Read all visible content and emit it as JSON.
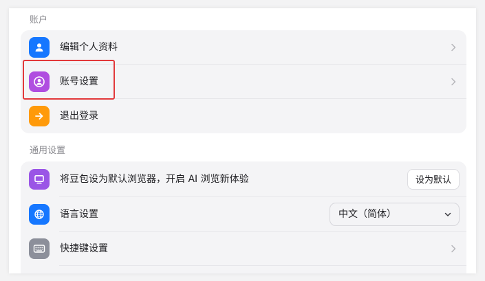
{
  "sections": {
    "account_title": "账户",
    "general_title": "通用设置"
  },
  "account": {
    "items": [
      {
        "label": "编辑个人资料",
        "icon": "person-icon",
        "icon_color": "#1677ff"
      },
      {
        "label": "账号设置",
        "icon": "account-circle-icon",
        "icon_color": "#b04ee0"
      },
      {
        "label": "退出登录",
        "icon": "arrow-right-icon",
        "icon_color": "#ff9a0a"
      }
    ]
  },
  "general": {
    "default_browser": {
      "label": "将豆包设为默认浏览器，开启 AI 浏览新体验",
      "button": "设为默认",
      "icon": "monitor-icon",
      "icon_color": "#9a55e6"
    },
    "language": {
      "label": "语言设置",
      "value": "中文（简体）",
      "icon": "globe-icon",
      "icon_color": "#1677ff"
    },
    "shortcuts": {
      "label": "快捷键设置",
      "icon": "keyboard-icon",
      "icon_color": "#8c8f9a"
    }
  },
  "annotation": {
    "highlight_color": "#e2383a"
  }
}
